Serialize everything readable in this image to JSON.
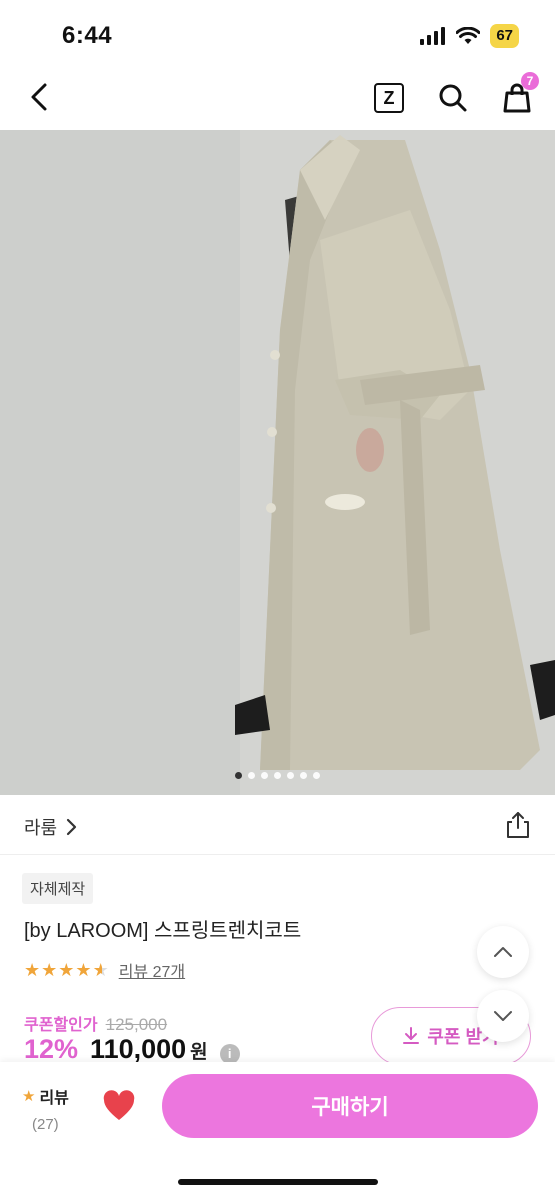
{
  "status_bar": {
    "time": "6:44",
    "battery": "67"
  },
  "nav": {
    "cart_count": "7",
    "z_label": "Z"
  },
  "gallery": {
    "dot_count": 7,
    "active_index": 0
  },
  "brand": {
    "name": "라룸"
  },
  "product": {
    "tag": "자체제작",
    "title": "[by LAROOM] 스프링트렌치코트",
    "rating": 4.5,
    "review_link": "리뷰 27개",
    "coupon_label": "쿠폰할인가",
    "original_price": "125,000",
    "discount": "12%",
    "price": "110,000",
    "currency": "원",
    "info": "i",
    "coupon_button": "쿠폰 받기"
  },
  "bottom": {
    "review_label": "리뷰",
    "review_count": "(27)",
    "buy_button": "구매하기"
  },
  "colors": {
    "accent": "#ec76de",
    "star": "#f0a53a",
    "heart": "#e8424c"
  }
}
